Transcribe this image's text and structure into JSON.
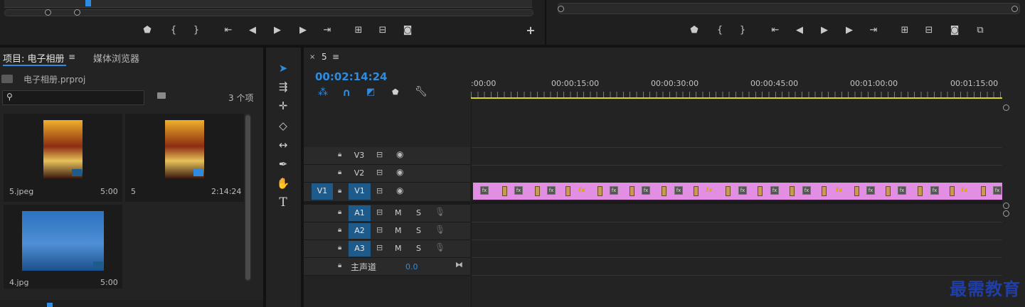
{
  "project_panel": {
    "tab_project": "项目: 电子相册",
    "tab_media_browser": "媒体浏览器",
    "project_file": "电子相册.prproj",
    "search_placeholder": "",
    "item_count": "3 个项",
    "items": [
      {
        "name": "5.jpeg",
        "duration": "5:00",
        "thumb": "one-piece-poster"
      },
      {
        "name": "5",
        "duration": "2:14:24",
        "thumb": "one-piece-sequence"
      },
      {
        "name": "4.jpg",
        "duration": "5:00",
        "thumb": "one-piece-banner"
      }
    ]
  },
  "timeline": {
    "tab_name": "5",
    "timecode": "00:02:14:24",
    "ruler_labels": [
      ":00:00",
      "00:00:15:00",
      "00:00:30:00",
      "00:00:45:00",
      "00:01:00:00",
      "00:01:15:00"
    ],
    "tracks_video": [
      {
        "id": "V3",
        "source_target": ""
      },
      {
        "id": "V2",
        "source_target": ""
      },
      {
        "id": "V1",
        "source_target": "V1"
      }
    ],
    "tracks_audio": [
      {
        "id": "A1",
        "m": "M",
        "s": "S"
      },
      {
        "id": "A2",
        "m": "M",
        "s": "S"
      },
      {
        "id": "A3",
        "m": "M",
        "s": "S"
      }
    ],
    "master": {
      "label": "主声道",
      "value": "0.0"
    },
    "clip_color": "#e28ee2",
    "timecode_color": "#2e8ce0"
  },
  "watermark": "最需教育"
}
